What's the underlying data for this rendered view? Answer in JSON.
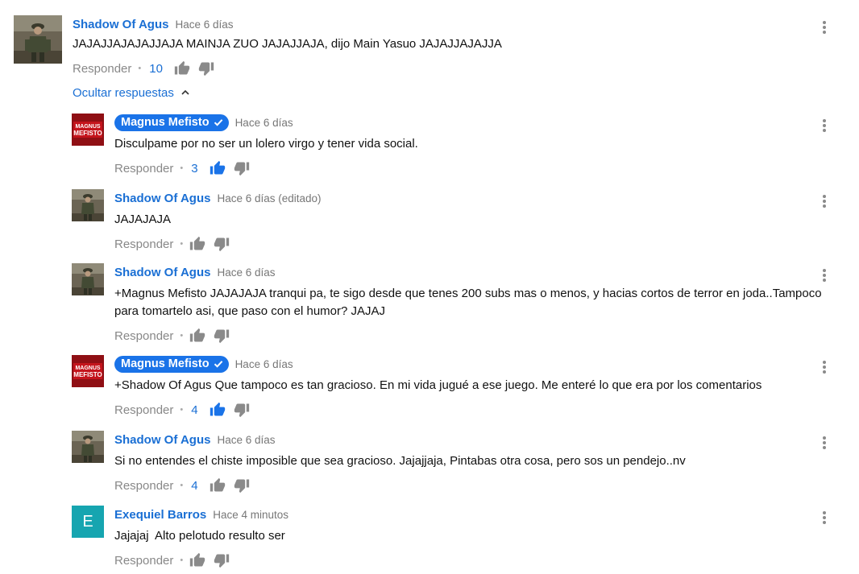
{
  "comments": [
    {
      "author": "Shadow Of Agus",
      "time": "Hace 6 días",
      "text": "JAJAJJAJAJAJJAJA MAINJA ZUO JAJAJJAJA, dijo Main Yasuo JAJAJJAJAJJA",
      "reply_label": "Responder",
      "likes": "10",
      "avatar_icon": "soldier-photo-avatar"
    }
  ],
  "hide_replies_label": "Ocultar respuestas",
  "replies": [
    {
      "author": "Magnus Mefisto",
      "verified": true,
      "time": "Hace 6 días",
      "text": "Disculpame por no ser un lolero virgo y tener vida social.",
      "reply_label": "Responder",
      "likes": "3",
      "liked": true,
      "avatar_icon": "magnus-mefisto-logo-avatar"
    },
    {
      "author": "Shadow Of Agus",
      "verified": false,
      "time": "Hace 6 días (editado)",
      "text": "JAJAJAJA",
      "reply_label": "Responder",
      "likes": "",
      "liked": false,
      "avatar_icon": "soldier-photo-avatar"
    },
    {
      "author": "Shadow Of Agus",
      "verified": false,
      "time": "Hace 6 días",
      "text": "+Magnus Mefisto JAJAJAJA tranqui pa, te sigo desde que tenes 200 subs mas o menos, y hacias cortos de terror en joda..Tampoco para tomartelo asi, que paso con el humor? JAJAJ",
      "reply_label": "Responder",
      "likes": "",
      "liked": false,
      "avatar_icon": "soldier-photo-avatar"
    },
    {
      "author": "Magnus Mefisto",
      "verified": true,
      "time": "Hace 6 días",
      "text": "+Shadow Of Agus Que tampoco es tan gracioso. En mi vida jugué a ese juego. Me enteré lo que era por los comentarios",
      "reply_label": "Responder",
      "likes": "4",
      "liked": true,
      "avatar_icon": "magnus-mefisto-logo-avatar"
    },
    {
      "author": "Shadow Of Agus",
      "verified": false,
      "time": "Hace 6 días",
      "text": "Si no entendes el chiste imposible que sea gracioso. Jajajjaja, Pintabas otra cosa, pero sos un pendejo..nv",
      "reply_label": "Responder",
      "likes": "4",
      "liked": false,
      "avatar_icon": "soldier-photo-avatar"
    },
    {
      "author": "Exequiel Barros",
      "verified": false,
      "time": "Hace 4 minutos",
      "text": "Jajajaj  Alto pelotudo resulto ser",
      "reply_label": "Responder",
      "likes": "",
      "liked": false,
      "avatar_letter": "E",
      "avatar_icon": "letter-avatar"
    }
  ],
  "colors": {
    "link_blue": "#1a6fd4",
    "liked_blue": "#1a73e8",
    "badge_blue": "#1a73e8",
    "gray_text": "#888888",
    "thumb_gray": "#8a8a8a",
    "letter_avatar_bg": "#16a5b0",
    "mefisto_red": "#c4141c"
  }
}
